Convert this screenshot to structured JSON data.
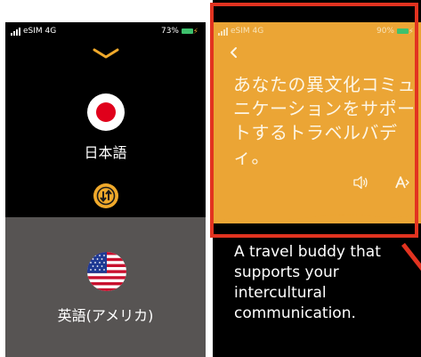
{
  "left_screen": {
    "status": {
      "carrier": "eSIM 4G",
      "battery": "73%"
    },
    "source_language": "日本語",
    "target_language": "英語(アメリカ)",
    "icons": {
      "collapse": "chevron-down-icon",
      "swap": "swap-arrows-icon"
    }
  },
  "right_screen": {
    "status": {
      "carrier": "eSIM 4G",
      "battery": "90%"
    },
    "japanese_text": "あなたの異文化コミュニケーションをサポートするトラベルバディ。",
    "english_text": "A travel buddy that supports your intercultural communication.",
    "icons": {
      "back": "chevron-left-icon",
      "speaker": "speaker-icon",
      "font_size": "font-size-icon"
    }
  },
  "colors": {
    "accent_orange": "#eba535",
    "highlight_red": "#e23320",
    "bottom_gray": "#575453",
    "japan_red": "#e0001b"
  }
}
